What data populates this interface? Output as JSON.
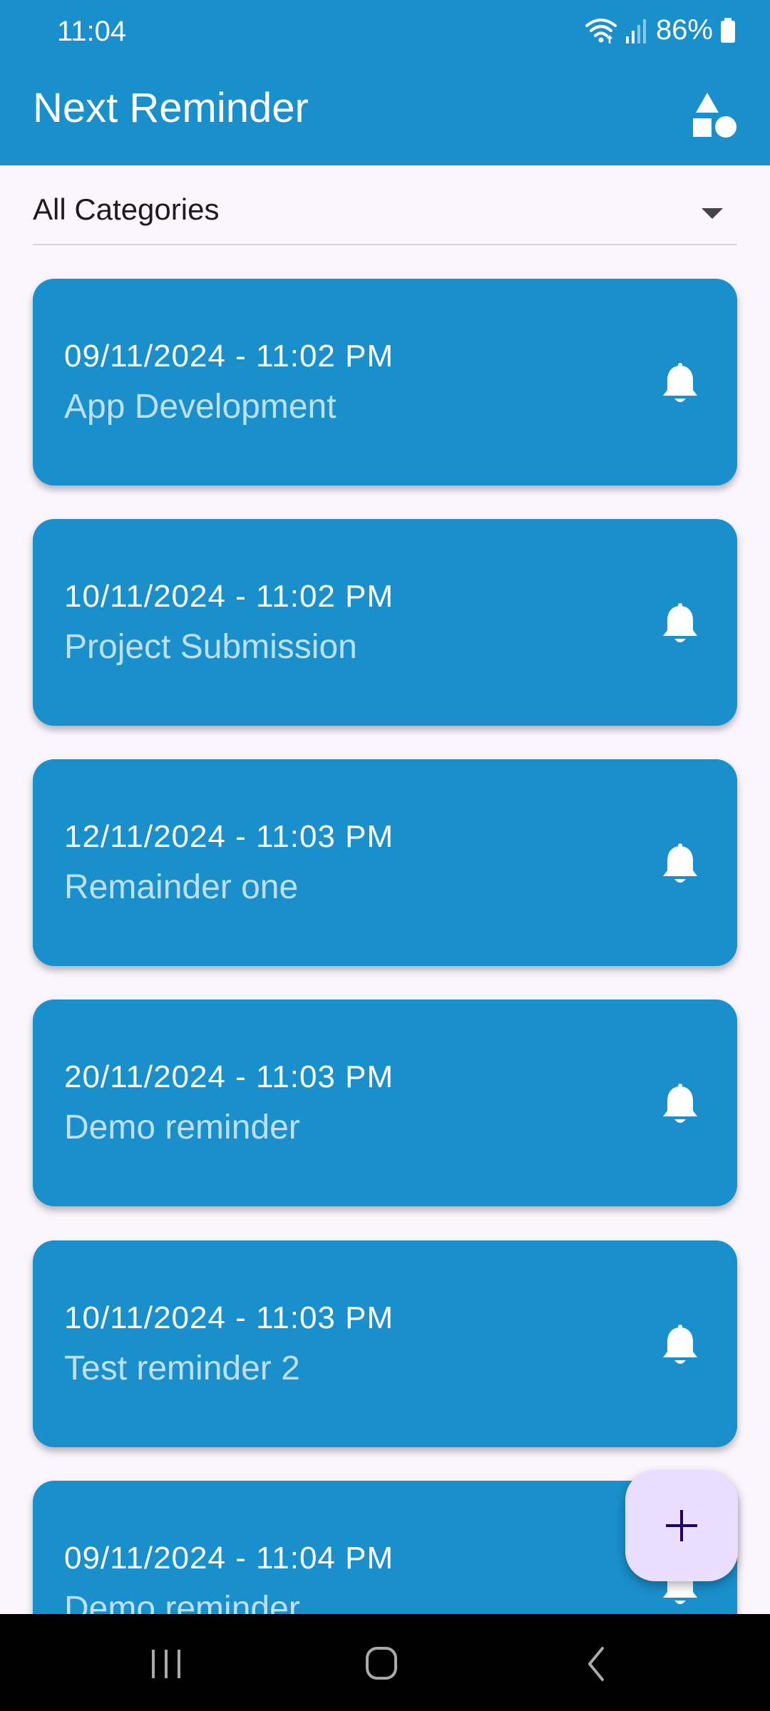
{
  "status_bar": {
    "time": "11:04",
    "battery": "86%",
    "icons": [
      "wifi-icon",
      "signal-icon",
      "battery-icon"
    ]
  },
  "app_bar": {
    "title": "Next Reminder",
    "action_icon": "category-shapes-icon"
  },
  "filter": {
    "selected": "All Categories"
  },
  "reminders": [
    {
      "datetime": "09/11/2024 - 11:02 PM",
      "title": "App Development"
    },
    {
      "datetime": "10/11/2024 - 11:02 PM",
      "title": "Project Submission"
    },
    {
      "datetime": "12/11/2024 - 11:03 PM",
      "title": "Remainder one"
    },
    {
      "datetime": "20/11/2024 - 11:03 PM",
      "title": "Demo reminder"
    },
    {
      "datetime": "10/11/2024 - 11:03 PM",
      "title": "Test reminder 2"
    },
    {
      "datetime": "09/11/2024 - 11:04 PM",
      "title": "Demo reminder"
    }
  ],
  "fab": {
    "icon": "plus-icon"
  },
  "nav_bar": {
    "buttons": [
      "recent-apps-icon",
      "home-icon",
      "back-icon"
    ]
  },
  "colors": {
    "primary": "#198FCC",
    "card_title": "#BFE0F2",
    "background": "#FBF6FD",
    "fab": "#EADDFD",
    "fab_icon": "#21005D"
  }
}
